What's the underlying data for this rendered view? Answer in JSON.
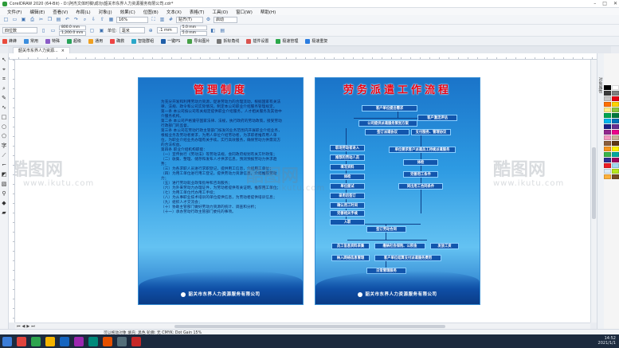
{
  "app": {
    "title": "CorelDRAW 2020 (64-Bit) - D:\\阿杰文体时稿\\成功\\韶关市东界人力资源服务有限公司.cdr*",
    "window_controls": [
      "–",
      "□",
      "✕"
    ]
  },
  "menu": [
    "文件(F)",
    "编辑(E)",
    "查看(V)",
    "布局(L)",
    "对象(J)",
    "效果(C)",
    "位图(B)",
    "文本(X)",
    "表格(T)",
    "工具(O)",
    "窗口(W)",
    "帮助(H)"
  ],
  "standard_toolbar": {
    "zoom": "16%",
    "snap_label": "贴齐(T)",
    "launch_label": "启动"
  },
  "property_bar": {
    "preset": "四位数",
    "width": "800.0 mm",
    "height": "1,200.0 mm",
    "units_label": "单位:",
    "units": "毫米",
    "nudge": ".1 mm",
    "dup_x": "5.0 mm",
    "dup_y": "5.0 mm"
  },
  "plugin_bar": [
    "蜂蜂",
    "常用",
    "特殊",
    "超级",
    "通用",
    "确救",
    "智能群组",
    "一键PS",
    "导出图片",
    "拆标角线",
    "插件设置",
    "极速管理",
    "极速重复"
  ],
  "document_tab": "韶关市东界人力资源...",
  "toolbox_icons": [
    "pointer-icon",
    "node-icon",
    "crop-icon",
    "zoom-icon",
    "freehand-icon",
    "artistic-media-icon",
    "rectangle-icon",
    "ellipse-icon",
    "polygon-icon",
    "text-icon",
    "parallel-dimension-icon",
    "connector-icon",
    "drop-shadow-icon",
    "transparency-icon",
    "eyedropper-icon",
    "interactive-fill-icon",
    "smart-fill-icon"
  ],
  "poster_left": {
    "title": "管理制度",
    "paragraphs": [
      "为充分开发和利用劳动力资源，促进劳动力的合理流动，根据国家有关法律、法规、政令和公司实际情况，制定本公司职业介绍服务管理规定。",
      "第一条 本公司按公司有关规定提供职业介绍服务，人才相关服务及其他中介服务机构。",
      "第二条 本公司严格遵守国家法律、法规，执行政府的劳动政策，接受劳动行政部门的监督。",
      "第三条 本公司在劳动行政主管部门核发的业务范围内开展职业介绍业务，根据业务及劳动者要求，为用人单位介绍劳动者，为求职者推荐用人单位，为职业介绍业务办理有关手续，实行高效服务，确保劳动力供需双方的合法权益。",
      "第四条 职业介绍机构职能：",
      "（一）宣传执行《劳动法》等劳动法规，会同政府规划有关方针政策；",
      "（二）收集、整理、储存和发布人才供求信息，预测预报劳动力供求趋势；",
      "（三）为各求职人员进行求职登记，提供用工信息，介绍用工单位；",
      "（四）为用工单位进行用工登记，提供劳动力资源信息，介绍推荐劳动力；",
      "（五）进行劳动就业政策指导和咨询服务；",
      "（六）为外来劳动力办理证件，为劳动者提供有关证明，推荐用工单位；",
      "（七）为用工单位代办用工手续；",
      "（八）为从事职业技术培训的单位提供信息，为劳动者提供培训信息；",
      "（九）组织人才交流会；",
      "（十）协助主管部门做好劳动力资源的统计、调查和分析；",
      "（十一）承办劳动行政主管部门委托的事项。"
    ],
    "footer": "韶关市东界人力资源服务有限公司"
  },
  "poster_right": {
    "title": "劳务派遣工作流程",
    "steps": [
      "客户单位提出需求",
      "客户激活评估",
      "公司提供派遣服务策划方案",
      "签订派遣协议",
      "支付服务、管理协议",
      "职场劳动者进入",
      "推荐的劳动人员",
      "填写资料",
      "体检",
      "单位面试",
      "录用后签订",
      "确认用工时间",
      "完善相关手续",
      "入职",
      "单位要求客户派遣员工持续派遣服务",
      "体检",
      "完善用工条件",
      "同出用工合同条件",
      "签订劳动合同",
      "员工信息资料采集",
      "缴纳社会保险、公积金",
      "发放工资",
      "纳入网络信息管理",
      "客户单位结算支付派遣服务费用",
      "日常管理服务"
    ],
    "footer": "韶关市东界人力资源服务有限公司"
  },
  "watermarks": [
    "酷图网",
    "www.ikutu.com"
  ],
  "docker_label": "对象属性",
  "status_text": "可以拖动对象   填充: 黑色   轮廓: 无   CMYK: Dot Gain 15%",
  "taskbar_time": "14:52",
  "taskbar_date": "2021/1/1",
  "colors": {
    "poster_title_red": "#e60012",
    "poster_blue": "#1a74c9",
    "flow_box": "#1256ad"
  },
  "palette": [
    "#000000",
    "#ffffff",
    "#3b3b3b",
    "#7f7f7f",
    "#c8c8c8",
    "#e60012",
    "#ff6f00",
    "#ffd400",
    "#ffef8a",
    "#8cc63f",
    "#00a651",
    "#007a3d",
    "#00b7ef",
    "#0072bc",
    "#1d2087",
    "#662d91",
    "#92278f",
    "#ec008c",
    "#f49ac2",
    "#c7b299",
    "#8b5e3c",
    "#603813",
    "#f7941d",
    "#fff200",
    "#39b54a",
    "#00a99d",
    "#2e3192",
    "#9e005d",
    "#ed1c24",
    "#a3d9f2",
    "#d9eaf7",
    "#b5e61d",
    "#fbb03b",
    "#754c24"
  ]
}
